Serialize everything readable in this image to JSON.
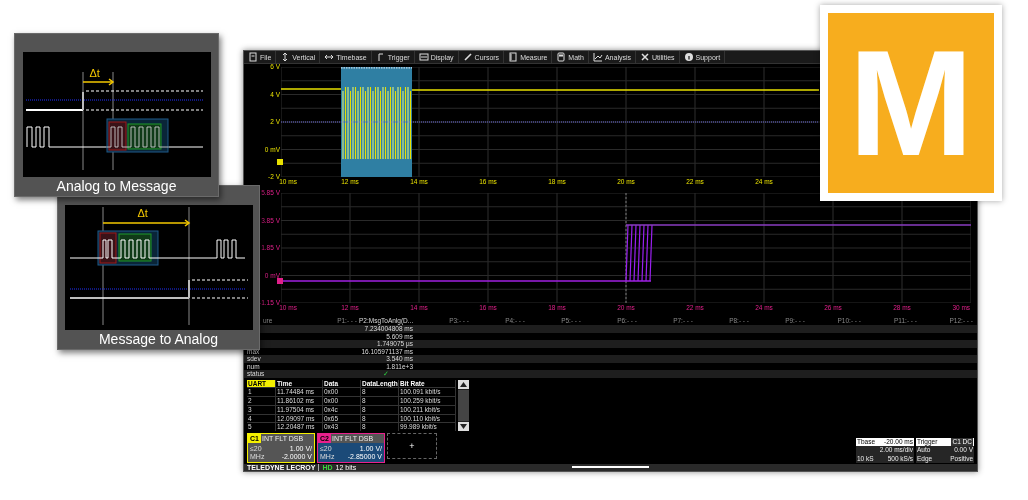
{
  "cards": [
    {
      "kind": "analog-to-message",
      "delta": "Δt",
      "title": "Analog to Message"
    },
    {
      "kind": "message-to-analog",
      "delta": "Δt",
      "title": "Message to Analog"
    }
  ],
  "scope": {
    "menu": [
      "File",
      "Vertical",
      "Timebase",
      "Trigger",
      "Display",
      "Cursors",
      "Measure",
      "Math",
      "Analysis",
      "Utilities",
      "Support"
    ],
    "plots": [
      {
        "kind": "analog",
        "color": "#e8e000",
        "y_labels": [
          "6 V",
          "4 V",
          "2 V",
          "0 mV",
          "-2 V"
        ],
        "x_labels": [
          "10 ms",
          "12 ms",
          "14 ms",
          "16 ms",
          "18 ms",
          "20 ms",
          "22 ms",
          "24 ms"
        ]
      },
      {
        "kind": "transition",
        "color": "#e0208a",
        "y_labels": [
          "5.85 V",
          "3.85 V",
          "1.85 V",
          "0 mV",
          "-1.15 V"
        ],
        "x_labels": [
          "10 ms",
          "12 ms",
          "14 ms",
          "16 ms",
          "18 ms",
          "20 ms",
          "22 ms",
          "24 ms",
          "26 ms",
          "28 ms",
          "30 ms"
        ]
      }
    ],
    "measurements": {
      "header": [
        "ure",
        "P1:- - -",
        "P2:MsgToAnlg(D...",
        "P3:- - -",
        "P4:- - -",
        "P5:- - -",
        "P6:- - -",
        "P7:- - -",
        "P8:- - -",
        "P9:- - -",
        "P10:- - -",
        "P11:- - -",
        "P12:- - -"
      ],
      "rows": [
        {
          "kind": "value",
          "value": "7.234004808 ms"
        },
        {
          "kind": "value",
          "value": "5.609 ms"
        },
        {
          "kind": "value",
          "value": "1.749075 µs"
        },
        {
          "kind": "value",
          "label": "max",
          "value": "16.105971137 ms"
        },
        {
          "kind": "value",
          "label": "sdev",
          "value": "3.540 ms"
        },
        {
          "kind": "value",
          "label": "num",
          "value": "1.811e+3"
        },
        {
          "kind": "check",
          "label": "status",
          "value": "✓"
        }
      ]
    },
    "uart": {
      "columns": [
        "UART",
        "Time",
        "Data",
        "DataLength",
        "Bit Rate"
      ],
      "rows": [
        [
          "1",
          "11.74484 ms",
          "0x00",
          "8",
          "100.091 kbit/s"
        ],
        [
          "2",
          "11.86102 ms",
          "0x00",
          "8",
          "100.259 kbit/s"
        ],
        [
          "3",
          "11.97504 ms",
          "0x4c",
          "8",
          "100.211 kbit/s"
        ],
        [
          "4",
          "12.09097 ms",
          "0x65",
          "8",
          "100.110 kbit/s"
        ],
        [
          "5",
          "12.20487 ms",
          "0x43",
          "8",
          "99.989 kbit/s"
        ]
      ]
    },
    "channels": [
      {
        "name": "C1",
        "color": "#f5f000",
        "flags": "INT FLT DSB",
        "bandwidth": "≤20 MHz",
        "scale": "1.00 V/",
        "offset": "-2.0000 V"
      },
      {
        "name": "C2",
        "color": "#e8208c",
        "flags": "INT FLT DSB",
        "bandwidth": "≤20 MHz",
        "scale": "1.00 V/",
        "offset": "-2.85000 V"
      }
    ],
    "add_channel": "+",
    "timebase": {
      "label": "Tbase",
      "offset": "-20.00 ms",
      "scale": "2.00 ms/div",
      "samples": "10 kS",
      "rate": "500 kS/s"
    },
    "trigger": {
      "label": "Trigger",
      "source": "C1 DC",
      "mode": "Auto",
      "level": "0.00 V",
      "type": "Edge",
      "slope": "Positive"
    },
    "footer": {
      "brand": "TELEDYNE LECROY",
      "hd": "HD",
      "bits": "12 bits"
    }
  },
  "logo": {
    "letter": "M"
  }
}
